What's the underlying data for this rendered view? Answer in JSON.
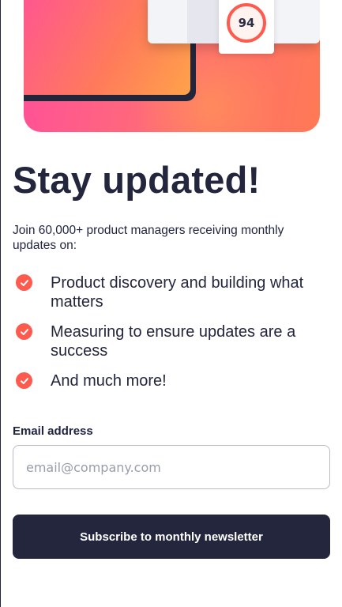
{
  "hero": {
    "score": "94",
    "colors": {
      "gradient_start": "#ff4f9a",
      "gradient_end": "#ff7a55",
      "accent": "#ff5a4e"
    }
  },
  "title": "Stay updated!",
  "intro": "Join 60,000+ product managers receiving monthly updates on:",
  "features": [
    {
      "icon": "check-icon",
      "label": "Product discovery and building what matters"
    },
    {
      "icon": "check-icon",
      "label": "Measuring to ensure updates are a success"
    },
    {
      "icon": "check-icon",
      "label": "And much more!"
    }
  ],
  "form": {
    "email_label": "Email address",
    "email_placeholder": "email@company.com",
    "email_value": "",
    "submit_label": "Subscribe to monthly newsletter",
    "button_color": "#23263d"
  }
}
